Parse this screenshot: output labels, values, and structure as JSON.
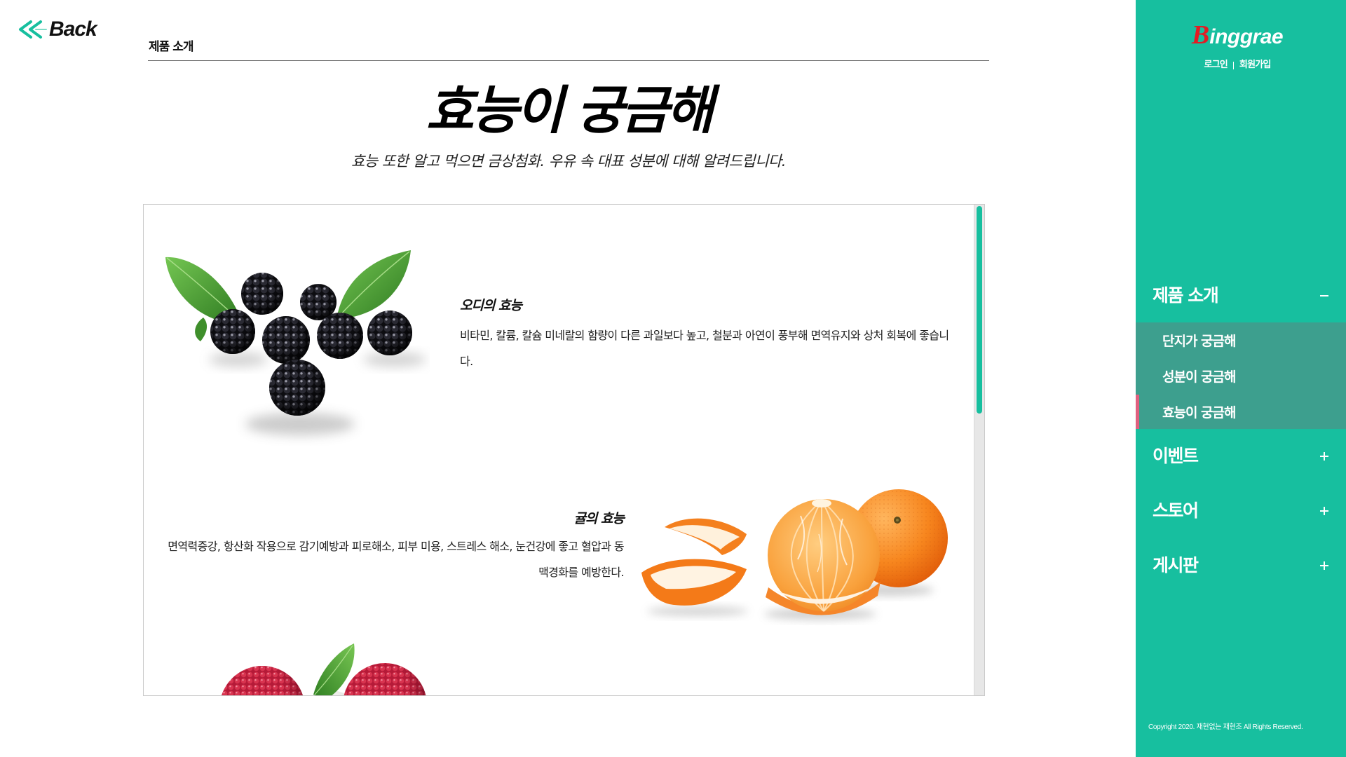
{
  "header": {
    "back_label": "Back",
    "back_icon": "double-chevron-left-icon",
    "breadcrumb": "제품 소개"
  },
  "page": {
    "title": "효능이 궁금해",
    "subtitle": "효능 또한 알고 먹으면 금상첨화. 우유 속 대표 성분에 대해 알려드립니다."
  },
  "items": [
    {
      "title": "오디의 효능",
      "description": "비타민, 칼륨, 칼슘 미네랄의 함량이 다른 과일보다 높고, 철분과 아연이 풍부해 면역유지와 상처 회복에 좋습니다.",
      "image": "blackberry-image"
    },
    {
      "title": "귤의 효능",
      "description": "면역력증강, 항산화 작용으로 감기예방과 피로해소, 피부 미용, 스트레스 해소, 눈건강에 좋고 혈압과 동맥경화를 예방한다.",
      "image": "tangerine-image"
    },
    {
      "image": "lychee-image"
    }
  ],
  "sidebar": {
    "logo": {
      "initial": "B",
      "rest": "inggrae"
    },
    "login": "로그인",
    "signup": "회원가입",
    "menu": [
      {
        "label": "제품 소개",
        "toggle_icon": "minus-icon",
        "expanded": true,
        "submenu": [
          {
            "label": "단지가 궁금해",
            "active": false
          },
          {
            "label": "성분이 궁금해",
            "active": false
          },
          {
            "label": "효능이 궁금해",
            "active": true
          }
        ]
      },
      {
        "label": "이벤트",
        "toggle_icon": "plus-icon",
        "expanded": false
      },
      {
        "label": "스토어",
        "toggle_icon": "plus-icon",
        "expanded": false
      },
      {
        "label": "게시판",
        "toggle_icon": "plus-icon",
        "expanded": false
      }
    ],
    "copyright": "Copyright 2020. 재현없는 재현조 All Rights Reserved."
  },
  "colors": {
    "accent": "#17bf9f",
    "submenu_bg": "#3d9f8e",
    "active_marker": "#e0607f",
    "text": "#111111"
  }
}
